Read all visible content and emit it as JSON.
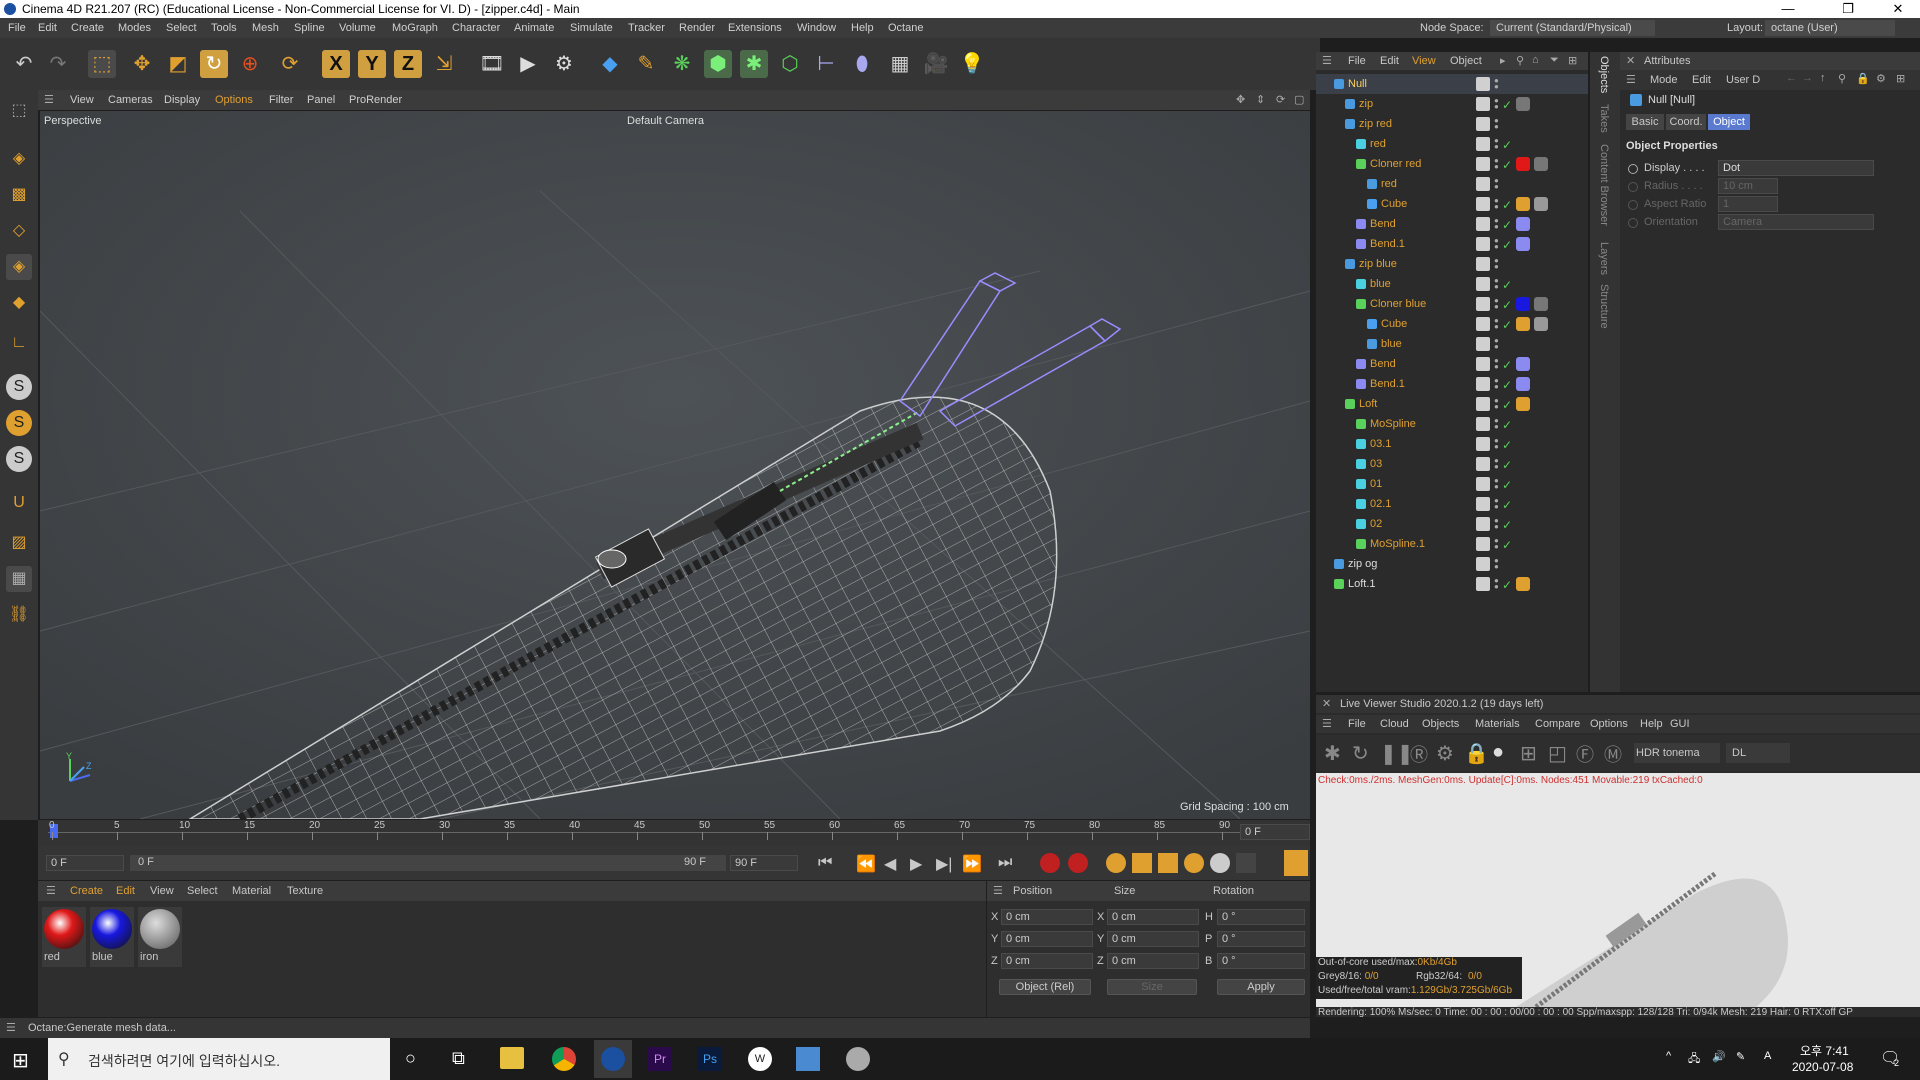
{
  "titlebar": {
    "title": "Cinema 4D R21.207 (RC) (Educational License - Non-Commercial License for VI. D) - [zipper.c4d] - Main",
    "minimize": "—",
    "maximize": "❐",
    "close": "✕"
  },
  "menubar": {
    "items": [
      "File",
      "Edit",
      "Create",
      "Modes",
      "Select",
      "Tools",
      "Mesh",
      "Spline",
      "Volume",
      "MoGraph",
      "Character",
      "Animate",
      "Simulate",
      "Tracker",
      "Render",
      "Extensions",
      "Window",
      "Help",
      "Octane"
    ],
    "node_space_label": "Node Space:",
    "node_space_value": "Current (Standard/Physical)",
    "layout_label": "Layout:",
    "layout_value": "octane (User)"
  },
  "viewport": {
    "menu": [
      "View",
      "Cameras",
      "Display",
      "Options",
      "Filter",
      "Panel",
      "ProRender"
    ],
    "label": "Perspective",
    "camera": "Default Camera",
    "grid_spacing": "Grid Spacing : 100 cm",
    "axis_y": "Y",
    "axis_z": "Z"
  },
  "timeline": {
    "ticks": [
      "0",
      "5",
      "10",
      "15",
      "20",
      "25",
      "30",
      "35",
      "40",
      "45",
      "50",
      "55",
      "60",
      "65",
      "70",
      "75",
      "80",
      "85",
      "90"
    ],
    "current_frame": "0 F",
    "start": "0 F",
    "range_start": "0 F",
    "range_end": "90 F",
    "end": "90 F"
  },
  "material_manager": {
    "menu": [
      "Create",
      "Edit",
      "View",
      "Select",
      "Material",
      "Texture"
    ],
    "materials": [
      {
        "name": "red",
        "color": "#e01818"
      },
      {
        "name": "blue",
        "color": "#1818e0"
      },
      {
        "name": "iron",
        "color": "#808080"
      }
    ]
  },
  "coords": {
    "headers": [
      "Position",
      "Size",
      "Rotation"
    ],
    "rows": [
      {
        "axis": "X",
        "pos": "0 cm",
        "size_axis": "X",
        "size": "0 cm",
        "rot_axis": "H",
        "rot": "0 °"
      },
      {
        "axis": "Y",
        "pos": "0 cm",
        "size_axis": "Y",
        "size": "0 cm",
        "rot_axis": "P",
        "rot": "0 °"
      },
      {
        "axis": "Z",
        "pos": "0 cm",
        "size_axis": "Z",
        "size": "0 cm",
        "rot_axis": "B",
        "rot": "0 °"
      }
    ],
    "mode": "Object (Rel)",
    "size_mode": "Size",
    "apply": "Apply"
  },
  "status": {
    "text": "Octane:Generate mesh data..."
  },
  "object_manager": {
    "menu": [
      "File",
      "Edit",
      "View",
      "Object"
    ],
    "objects": [
      {
        "name": "Null",
        "indent": 0,
        "sel": true,
        "type": "null"
      },
      {
        "name": "zip",
        "indent": 1,
        "type": "null"
      },
      {
        "name": "zip red",
        "indent": 1,
        "type": "null"
      },
      {
        "name": "red",
        "indent": 2,
        "type": "spline"
      },
      {
        "name": "Cloner red",
        "indent": 2,
        "type": "cloner"
      },
      {
        "name": "red",
        "indent": 3,
        "type": "null"
      },
      {
        "name": "Cube",
        "indent": 3,
        "type": "cube"
      },
      {
        "name": "Bend",
        "indent": 2,
        "type": "deformer"
      },
      {
        "name": "Bend.1",
        "indent": 2,
        "type": "deformer"
      },
      {
        "name": "zip blue",
        "indent": 1,
        "type": "null"
      },
      {
        "name": "blue",
        "indent": 2,
        "type": "spline"
      },
      {
        "name": "Cloner blue",
        "indent": 2,
        "type": "cloner"
      },
      {
        "name": "Cube",
        "indent": 3,
        "type": "cube"
      },
      {
        "name": "blue",
        "indent": 3,
        "type": "null"
      },
      {
        "name": "Bend",
        "indent": 2,
        "type": "deformer"
      },
      {
        "name": "Bend.1",
        "indent": 2,
        "type": "deformer"
      },
      {
        "name": "Loft",
        "indent": 1,
        "type": "loft"
      },
      {
        "name": "MoSpline",
        "indent": 2,
        "type": "mospline"
      },
      {
        "name": "03.1",
        "indent": 2,
        "type": "spline"
      },
      {
        "name": "03",
        "indent": 2,
        "type": "spline"
      },
      {
        "name": "01",
        "indent": 2,
        "type": "spline"
      },
      {
        "name": "02.1",
        "indent": 2,
        "type": "spline"
      },
      {
        "name": "02",
        "indent": 2,
        "type": "spline"
      },
      {
        "name": "MoSpline.1",
        "indent": 2,
        "type": "mospline"
      },
      {
        "name": "zip og",
        "indent": 0,
        "type": "null"
      },
      {
        "name": "Loft.1",
        "indent": 0,
        "type": "loft"
      }
    ]
  },
  "side_tabs": [
    "Objects",
    "Takes",
    "Content Browser",
    "Layers",
    "Structure"
  ],
  "attributes": {
    "title": "Attributes",
    "menu": [
      "Mode",
      "Edit",
      "User D"
    ],
    "object_name": "Null [Null]",
    "tabs": [
      "Basic",
      "Coord.",
      "Object"
    ],
    "section": "Object Properties",
    "props": [
      {
        "label": "Display . . . .",
        "value": "Dot",
        "enabled": true
      },
      {
        "label": "Radius . . . .",
        "value": "10 cm",
        "enabled": false
      },
      {
        "label": "Aspect Ratio",
        "value": "1",
        "enabled": false
      },
      {
        "label": "Orientation",
        "value": "Camera",
        "enabled": false
      }
    ]
  },
  "live_viewer": {
    "title": "Live Viewer Studio 2020.1.2 (19 days left)",
    "menu": [
      "File",
      "Cloud",
      "Objects",
      "Materials",
      "Compare",
      "Options",
      "Help",
      "GUI"
    ],
    "tonemap": "HDR tonema",
    "kernel": "DL",
    "info": "Check:0ms./2ms. MeshGen:0ms. Update[C]:0ms. Nodes:451 Movable:219 txCached:0",
    "mem1_label": "Out-of-core used/max:",
    "mem1_value": "0Kb/4Gb",
    "mem2_a_label": "Grey8/16:",
    "mem2_a_value": "0/0",
    "mem2_b_label": "Rgb32/64:",
    "mem2_b_value": "0/0",
    "mem3_label": "Used/free/total vram:",
    "mem3_value": "1.129Gb/3.725Gb/6Gb",
    "render_stats": "Rendering: 100% Ms/sec: 0   Time: 00 : 00 : 00/00 : 00 : 00       Spp/maxspp: 128/128   Tri: 0/94k   Mesh: 219   Hair: 0   RTX:off   GP"
  },
  "taskbar": {
    "search_placeholder": "검색하려면 여기에 입력하십시오.",
    "time": "오후 7:41",
    "date": "2020-07-08",
    "ime": "A",
    "notifications": "2"
  }
}
